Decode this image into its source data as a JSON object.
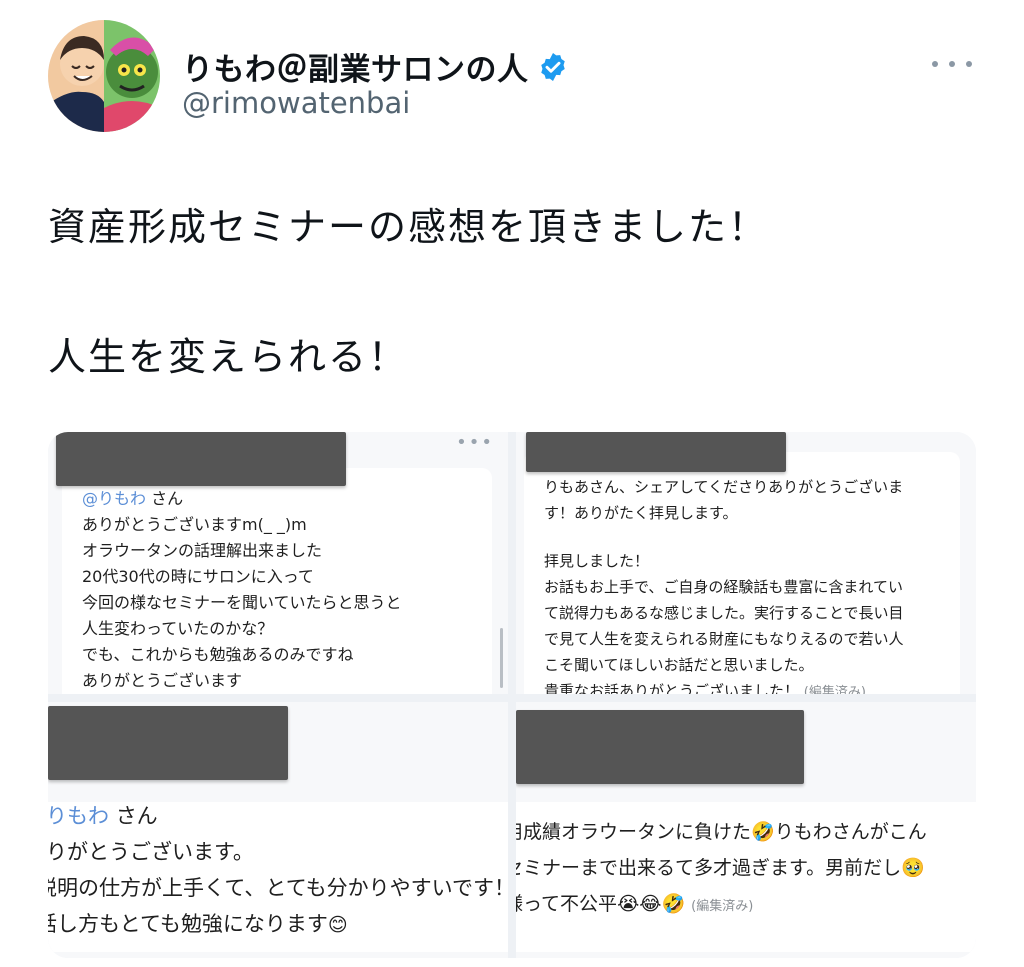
{
  "tweet": {
    "display_name": "りもわ＠副業サロンの人",
    "handle": "@rimowatenbai",
    "text_line1": "資産形成セミナーの感想を頂きました！",
    "text_line2": "人生を変えられる！"
  },
  "icons": {
    "verified": "verified-badge-icon",
    "more": "more-options-icon"
  },
  "colors": {
    "verified_blue": "#1d9bf0",
    "mention_blue": "#5b8ed6",
    "redaction_gray": "#555555"
  },
  "media": {
    "tile1": {
      "mention": "@りもわ",
      "lines": [
        "さん",
        "ありがとうございますm(_ _)m",
        "オラウータンの話理解出来ました",
        "20代30代の時にサロンに入って",
        "今回の様なセミナーを聞いていたらと思うと",
        "人生変わっていたのかな？",
        "でも、これからも勉強あるのみですね",
        "ありがとうございます"
      ]
    },
    "tile2": {
      "lines": [
        "りもあさん、シェアしてくださりありがとうございま",
        "す！ありがたく拝見します。",
        "",
        "拝見しました！",
        "お話もお上手で、ご自身の経験話も豊富に含まれてい",
        "て説得力もあるな感じました。実行することで長い目",
        "で見て人生を変えられる財産にもなりえるので若い人",
        "こそ聞いてほしいお話だと思いました。",
        "貴重なお話ありがとうございました！"
      ],
      "edited": "(編集済み)"
    },
    "tile3": {
      "mention": "りもわ",
      "lines": [
        "さん",
        "りがとうございます。",
        "説明の仕方が上手くて、とても分かりやすいです！",
        "話し方もとても勉強になります"
      ],
      "emoji": "😊"
    },
    "tile4": {
      "line1_a": "用成績オラウータンに負けた",
      "line1_emoji": "🤣",
      "line1_b": "りもわさんがこん",
      "line2": "セミナーまで出来るて多才過ぎます。男前だし",
      "line2_emoji": "🥹",
      "line3": "様って不公平",
      "line3_emojis": "😭😂🤣",
      "edited": "(編集済み)"
    }
  }
}
